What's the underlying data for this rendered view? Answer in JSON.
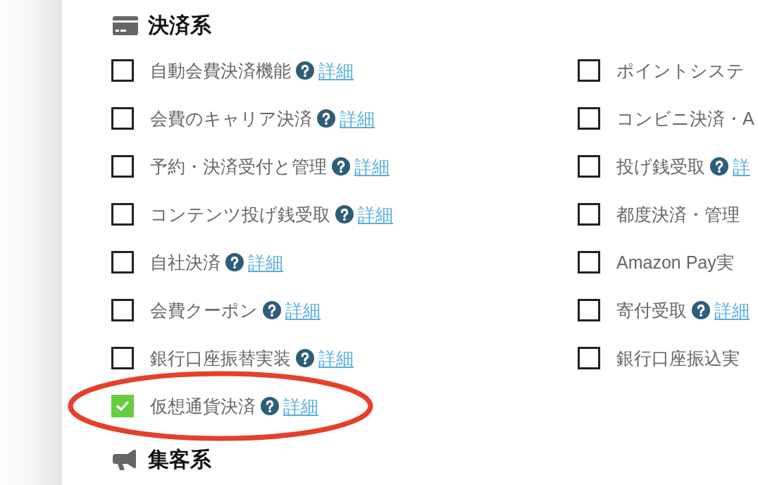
{
  "sections": [
    {
      "title": "決済系",
      "columns": [
        {
          "items": [
            {
              "label": "自動会費決済機能",
              "checked": false,
              "help": true,
              "link": "詳細",
              "highlighted": false
            },
            {
              "label": "会費のキャリア決済",
              "checked": false,
              "help": true,
              "link": "詳細",
              "highlighted": false
            },
            {
              "label": "予約・決済受付と管理",
              "checked": false,
              "help": true,
              "link": "詳細",
              "highlighted": false
            },
            {
              "label": "コンテンツ投げ銭受取",
              "checked": false,
              "help": true,
              "link": "詳細",
              "highlighted": false
            },
            {
              "label": "自社決済",
              "checked": false,
              "help": true,
              "link": "詳細",
              "highlighted": false
            },
            {
              "label": "会費クーポン",
              "checked": false,
              "help": true,
              "link": "詳細",
              "highlighted": false
            },
            {
              "label": "銀行口座振替実装",
              "checked": false,
              "help": true,
              "link": "詳細",
              "highlighted": false
            },
            {
              "label": "仮想通貨決済",
              "checked": true,
              "help": true,
              "link": "詳細",
              "highlighted": true
            }
          ]
        },
        {
          "items": [
            {
              "label": "ポイントシステ",
              "checked": false,
              "help": false,
              "highlighted": false
            },
            {
              "label": "コンビニ決済・A",
              "checked": false,
              "help": false,
              "highlighted": false
            },
            {
              "label": "投げ銭受取",
              "checked": false,
              "help": true,
              "link": "詳",
              "highlighted": false
            },
            {
              "label": "都度決済・管理",
              "checked": false,
              "help": false,
              "highlighted": false
            },
            {
              "label": "Amazon Pay実",
              "checked": false,
              "help": false,
              "highlighted": false
            },
            {
              "label": "寄付受取",
              "checked": false,
              "help": true,
              "link": "詳細",
              "highlighted": false
            },
            {
              "label": "銀行口座振込実",
              "checked": false,
              "help": false,
              "highlighted": false
            }
          ]
        }
      ]
    },
    {
      "title": "集客系"
    }
  ]
}
